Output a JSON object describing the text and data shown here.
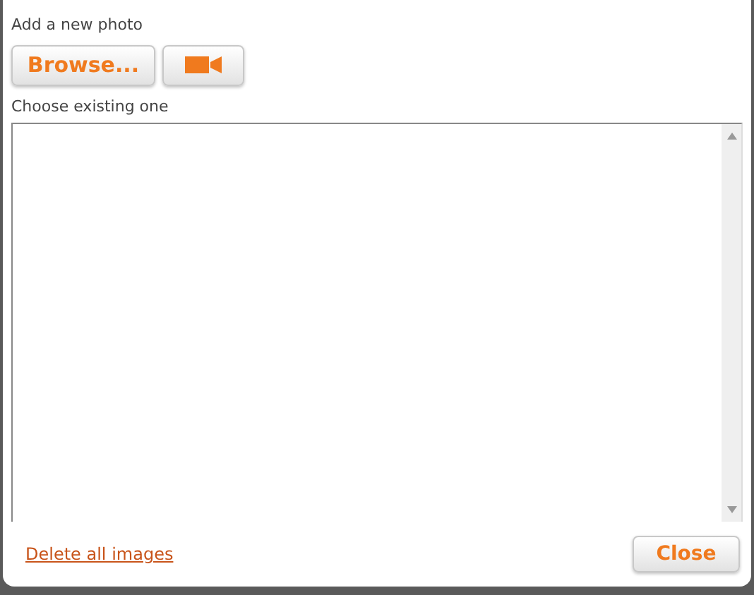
{
  "upload": {
    "label": "Add a new photo",
    "browse_button": "Browse..."
  },
  "existing": {
    "label": "Choose existing one"
  },
  "footer": {
    "delete_link": "Delete all images",
    "close_button": "Close"
  }
}
